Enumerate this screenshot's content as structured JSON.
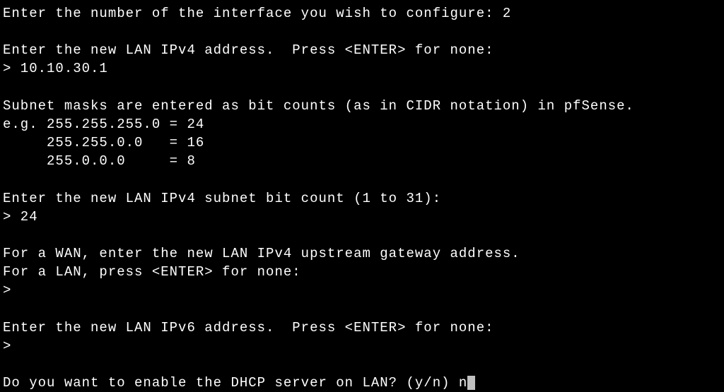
{
  "lines": {
    "l1": "Enter the number of the interface you wish to configure: 2",
    "blank1": "",
    "l2": "Enter the new LAN IPv4 address.  Press <ENTER> for none:",
    "l3": "> 10.10.30.1",
    "blank2": "",
    "l4": "Subnet masks are entered as bit counts (as in CIDR notation) in pfSense.",
    "l5": "e.g. 255.255.255.0 = 24",
    "l6": "     255.255.0.0   = 16",
    "l7": "     255.0.0.0     = 8",
    "blank3": "",
    "l8": "Enter the new LAN IPv4 subnet bit count (1 to 31):",
    "l9": "> 24",
    "blank4": "",
    "l10": "For a WAN, enter the new LAN IPv4 upstream gateway address.",
    "l11": "For a LAN, press <ENTER> for none:",
    "l12": ">",
    "blank5": "",
    "l13": "Enter the new LAN IPv6 address.  Press <ENTER> for none:",
    "l14": ">",
    "blank6": "",
    "l15": "Do you want to enable the DHCP server on LAN? (y/n) n"
  }
}
